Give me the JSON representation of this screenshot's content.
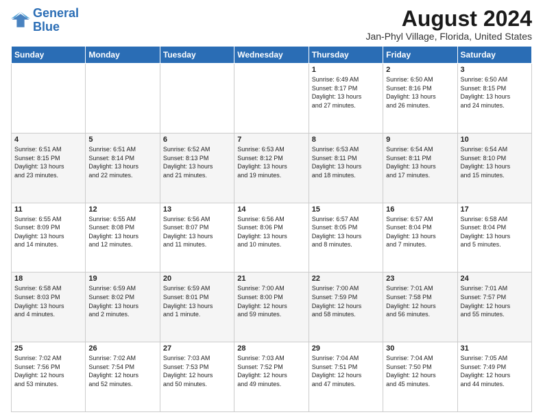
{
  "logo": {
    "line1": "General",
    "line2": "Blue"
  },
  "title": "August 2024",
  "subtitle": "Jan-Phyl Village, Florida, United States",
  "weekdays": [
    "Sunday",
    "Monday",
    "Tuesday",
    "Wednesday",
    "Thursday",
    "Friday",
    "Saturday"
  ],
  "weeks": [
    [
      {
        "day": "",
        "info": ""
      },
      {
        "day": "",
        "info": ""
      },
      {
        "day": "",
        "info": ""
      },
      {
        "day": "",
        "info": ""
      },
      {
        "day": "1",
        "info": "Sunrise: 6:49 AM\nSunset: 8:17 PM\nDaylight: 13 hours\nand 27 minutes."
      },
      {
        "day": "2",
        "info": "Sunrise: 6:50 AM\nSunset: 8:16 PM\nDaylight: 13 hours\nand 26 minutes."
      },
      {
        "day": "3",
        "info": "Sunrise: 6:50 AM\nSunset: 8:15 PM\nDaylight: 13 hours\nand 24 minutes."
      }
    ],
    [
      {
        "day": "4",
        "info": "Sunrise: 6:51 AM\nSunset: 8:15 PM\nDaylight: 13 hours\nand 23 minutes."
      },
      {
        "day": "5",
        "info": "Sunrise: 6:51 AM\nSunset: 8:14 PM\nDaylight: 13 hours\nand 22 minutes."
      },
      {
        "day": "6",
        "info": "Sunrise: 6:52 AM\nSunset: 8:13 PM\nDaylight: 13 hours\nand 21 minutes."
      },
      {
        "day": "7",
        "info": "Sunrise: 6:53 AM\nSunset: 8:12 PM\nDaylight: 13 hours\nand 19 minutes."
      },
      {
        "day": "8",
        "info": "Sunrise: 6:53 AM\nSunset: 8:11 PM\nDaylight: 13 hours\nand 18 minutes."
      },
      {
        "day": "9",
        "info": "Sunrise: 6:54 AM\nSunset: 8:11 PM\nDaylight: 13 hours\nand 17 minutes."
      },
      {
        "day": "10",
        "info": "Sunrise: 6:54 AM\nSunset: 8:10 PM\nDaylight: 13 hours\nand 15 minutes."
      }
    ],
    [
      {
        "day": "11",
        "info": "Sunrise: 6:55 AM\nSunset: 8:09 PM\nDaylight: 13 hours\nand 14 minutes."
      },
      {
        "day": "12",
        "info": "Sunrise: 6:55 AM\nSunset: 8:08 PM\nDaylight: 13 hours\nand 12 minutes."
      },
      {
        "day": "13",
        "info": "Sunrise: 6:56 AM\nSunset: 8:07 PM\nDaylight: 13 hours\nand 11 minutes."
      },
      {
        "day": "14",
        "info": "Sunrise: 6:56 AM\nSunset: 8:06 PM\nDaylight: 13 hours\nand 10 minutes."
      },
      {
        "day": "15",
        "info": "Sunrise: 6:57 AM\nSunset: 8:05 PM\nDaylight: 13 hours\nand 8 minutes."
      },
      {
        "day": "16",
        "info": "Sunrise: 6:57 AM\nSunset: 8:04 PM\nDaylight: 13 hours\nand 7 minutes."
      },
      {
        "day": "17",
        "info": "Sunrise: 6:58 AM\nSunset: 8:04 PM\nDaylight: 13 hours\nand 5 minutes."
      }
    ],
    [
      {
        "day": "18",
        "info": "Sunrise: 6:58 AM\nSunset: 8:03 PM\nDaylight: 13 hours\nand 4 minutes."
      },
      {
        "day": "19",
        "info": "Sunrise: 6:59 AM\nSunset: 8:02 PM\nDaylight: 13 hours\nand 2 minutes."
      },
      {
        "day": "20",
        "info": "Sunrise: 6:59 AM\nSunset: 8:01 PM\nDaylight: 13 hours\nand 1 minute."
      },
      {
        "day": "21",
        "info": "Sunrise: 7:00 AM\nSunset: 8:00 PM\nDaylight: 12 hours\nand 59 minutes."
      },
      {
        "day": "22",
        "info": "Sunrise: 7:00 AM\nSunset: 7:59 PM\nDaylight: 12 hours\nand 58 minutes."
      },
      {
        "day": "23",
        "info": "Sunrise: 7:01 AM\nSunset: 7:58 PM\nDaylight: 12 hours\nand 56 minutes."
      },
      {
        "day": "24",
        "info": "Sunrise: 7:01 AM\nSunset: 7:57 PM\nDaylight: 12 hours\nand 55 minutes."
      }
    ],
    [
      {
        "day": "25",
        "info": "Sunrise: 7:02 AM\nSunset: 7:56 PM\nDaylight: 12 hours\nand 53 minutes."
      },
      {
        "day": "26",
        "info": "Sunrise: 7:02 AM\nSunset: 7:54 PM\nDaylight: 12 hours\nand 52 minutes."
      },
      {
        "day": "27",
        "info": "Sunrise: 7:03 AM\nSunset: 7:53 PM\nDaylight: 12 hours\nand 50 minutes."
      },
      {
        "day": "28",
        "info": "Sunrise: 7:03 AM\nSunset: 7:52 PM\nDaylight: 12 hours\nand 49 minutes."
      },
      {
        "day": "29",
        "info": "Sunrise: 7:04 AM\nSunset: 7:51 PM\nDaylight: 12 hours\nand 47 minutes."
      },
      {
        "day": "30",
        "info": "Sunrise: 7:04 AM\nSunset: 7:50 PM\nDaylight: 12 hours\nand 45 minutes."
      },
      {
        "day": "31",
        "info": "Sunrise: 7:05 AM\nSunset: 7:49 PM\nDaylight: 12 hours\nand 44 minutes."
      }
    ]
  ]
}
